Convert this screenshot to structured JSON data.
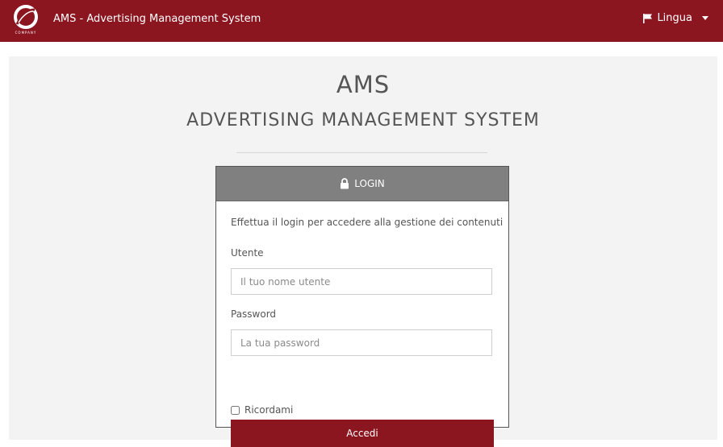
{
  "navbar": {
    "logo_text": "COMPANY",
    "brand": "AMS - Advertising Management System",
    "language_label": "Lingua"
  },
  "main": {
    "title": "AMS",
    "subtitle": "ADVERTISING MANAGEMENT SYSTEM"
  },
  "login": {
    "header": "LOGIN",
    "intro": "Effettua il login per accedere alla gestione dei contenuti",
    "username_label": "Utente",
    "username_placeholder": "Il tuo nome utente",
    "username_value": "",
    "password_label": "Password",
    "password_placeholder": "La tua password",
    "password_value": "",
    "remember_label": "Ricordami",
    "remember_checked": false,
    "submit_label": "Accedi"
  },
  "colors": {
    "brand": "#8b1620",
    "card_header": "#808080",
    "panel": "#f3f3f3"
  },
  "icons": [
    "company-logo-icon",
    "flag-icon",
    "caret-down-icon",
    "lock-icon"
  ]
}
